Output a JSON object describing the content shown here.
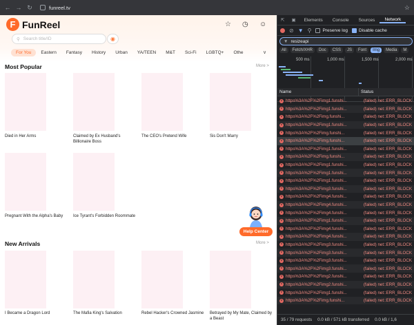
{
  "browser": {
    "url": "funreel.tv"
  },
  "site": {
    "brand": "FunReel",
    "brand_color": "#ff6a2a",
    "search_placeholder": "Search title/ID",
    "categories": [
      "For You",
      "Eastern",
      "Fantasy",
      "History",
      "Urban",
      "YA/TEEN",
      "M&T",
      "Sci-Fi",
      "LGBTQ+",
      "Othe"
    ],
    "more_categories": "∨",
    "sections": [
      {
        "title": "Most Popular",
        "more": "More >",
        "items": [
          "Died in Her Arms",
          "Claimed by Ex Husband's Billionaire Boss",
          "The CEO's Pretend Wife",
          "Sis Don't Marry",
          "Pregnant With the Alpha's Baby",
          "Ice Tyrant's Forbidden Roommate"
        ]
      },
      {
        "title": "New Arrivals",
        "more": "More >",
        "items": [
          "I Became a Dragon Lord",
          "The Mafia King's Salvation",
          "Rebel Hacker's Crowned Jasmine",
          "Betrayed by My Mate, Claimed by a Beast"
        ]
      }
    ],
    "help_center": "Help Center"
  },
  "devtools": {
    "tabs": [
      "Elements",
      "Console",
      "Sources",
      "Network"
    ],
    "active_tab": "Network",
    "preserve_log": "Preserve log",
    "disable_cache": "Disable cache",
    "filter_value": "resizeapi",
    "type_filters": [
      "All",
      "Fetch/XHR",
      "Doc",
      "CSS",
      "JS",
      "Font",
      "Img",
      "Media",
      "M"
    ],
    "active_type": "Img",
    "timeline_ticks": [
      "500 ms",
      "1,000 ms",
      "1,500 ms",
      "2,000 ms"
    ],
    "col_name": "Name",
    "col_status": "Status",
    "requests": [
      "https%3A%2F%2Fimg1.funshi...",
      "https%3A%2F%2Fimg1.funshi...",
      "https%3A%2F%2Fimg.funshi...",
      "https%3A%2F%2Fimg1.funshi...",
      "https%3A%2F%2Fimg.funshi...",
      "https%3A%2F%2Fimg.funshi...",
      "https%3A%2F%2Fimg1.funshi...",
      "https%3A%2F%2Fimg.funshi...",
      "https%3A%2F%2Fimg1.funshi...",
      "https%3A%2F%2Fimg1.funshi...",
      "https%3A%2F%2Fimg1.funshi...",
      "https%3A%2F%2Fimg3.funshi...",
      "https%3A%2F%2Fimg4.funshi...",
      "https%3A%2F%2Fimg4.funshi...",
      "https%3A%2F%2Fimg4.funshi...",
      "https%3A%2F%2Fimg1.funshi...",
      "https%3A%2F%2Fimg4.funshi...",
      "https%3A%2F%2Fimg4.funshi...",
      "https%3A%2F%2Fimg3.funshi...",
      "https%3A%2F%2Fimg3.funshi...",
      "https%3A%2F%2Fimg3.funshi...",
      "https%3A%2F%2Fimg3.funshi...",
      "https%3A%2F%2Fimg2.funshi...",
      "https%3A%2F%2Fimg2.funshi...",
      "https%3A%2F%2Fimg1.funshi...",
      "https%3A%2F%2Fimg.funshi..."
    ],
    "status_text": "(failed) net::ERR_BLOCK",
    "selected_row": 5,
    "summary_requests": "35 / 79 requests",
    "summary_transferred": "0.0 kB / 571 kB transferred",
    "summary_resources": "0.0 kB / 1,6"
  }
}
